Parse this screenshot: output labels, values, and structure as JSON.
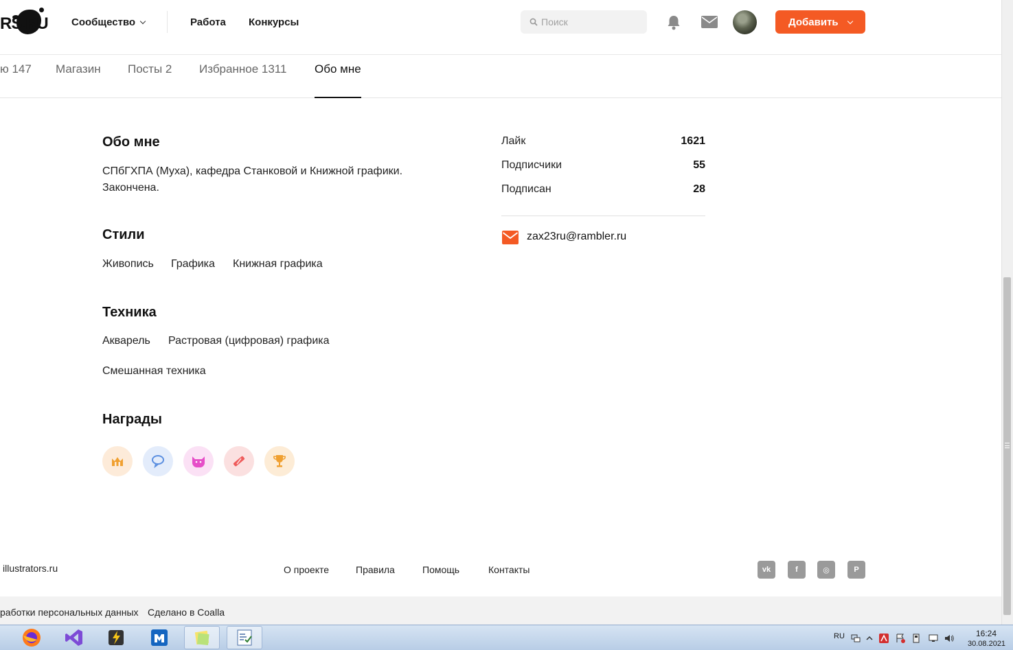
{
  "header": {
    "logo_text": "RS.RU",
    "nav": [
      {
        "label": "Сообщество"
      },
      {
        "label": "Работа"
      },
      {
        "label": "Конкурсы"
      }
    ],
    "search_placeholder": "Поиск",
    "add_button": "Добавить",
    "icons": [
      "search-icon",
      "bell-icon",
      "mail-icon",
      "avatar",
      "chevron-down-icon"
    ]
  },
  "tabs": [
    {
      "label": "ю 147"
    },
    {
      "label": "Магазин"
    },
    {
      "label": "Посты 2"
    },
    {
      "label": "Избранное 1311"
    },
    {
      "label": "Обо мне",
      "active": true
    }
  ],
  "about": {
    "title": "Обо мне",
    "text": "СПбГХПА (Муха), кафедра Станковой и Книжной графики. Закончена."
  },
  "styles": {
    "title": "Стили",
    "items": [
      "Живопись",
      "Графика",
      "Книжная графика"
    ]
  },
  "technique": {
    "title": "Техника",
    "items": [
      "Акварель",
      "Растровая (цифровая) графика",
      "Смешанная техника"
    ]
  },
  "awards": {
    "title": "Награды",
    "items": [
      {
        "icon": "crown-award-icon",
        "bg": "#fdebd9",
        "color": "#f0a030"
      },
      {
        "icon": "speech-bubble-award-icon",
        "bg": "#e3ecfb",
        "color": "#5b8fe0"
      },
      {
        "icon": "cat-award-icon",
        "bg": "#fbe1f5",
        "color": "#e64ec8"
      },
      {
        "icon": "pencil-award-icon",
        "bg": "#fbe0e0",
        "color": "#ef5b5b"
      },
      {
        "icon": "trophy-award-icon",
        "bg": "#fdecd6",
        "color": "#f0a030"
      }
    ]
  },
  "stats": [
    {
      "label": "Лайк",
      "value": "1621"
    },
    {
      "label": "Подписчики",
      "value": "55"
    },
    {
      "label": "Подписан",
      "value": "28"
    }
  ],
  "contact": {
    "email": "zax23ru@rambler.ru"
  },
  "footer": {
    "brand": "illustrators.ru",
    "links": [
      "О проекте",
      "Правила",
      "Помощь",
      "Контакты"
    ],
    "social": [
      {
        "icon": "vk-icon",
        "label": "vk"
      },
      {
        "icon": "facebook-icon",
        "label": "f"
      },
      {
        "icon": "instagram-icon",
        "label": "◎"
      },
      {
        "icon": "pinterest-icon",
        "label": "P"
      }
    ],
    "sub_left": "работки персональных данных",
    "sub_right": "Сделано в Coalla"
  },
  "taskbar": {
    "lang": "RU",
    "time": "16:24",
    "date": "30.08.2021",
    "apps": [
      "firefox-icon",
      "visual-studio-icon",
      "winamp-icon",
      "maxthon-icon",
      "sticky-notes-icon",
      "task-manager-icon"
    ]
  },
  "colors": {
    "accent": "#f45a24",
    "text": "#111111",
    "muted": "#666666"
  }
}
